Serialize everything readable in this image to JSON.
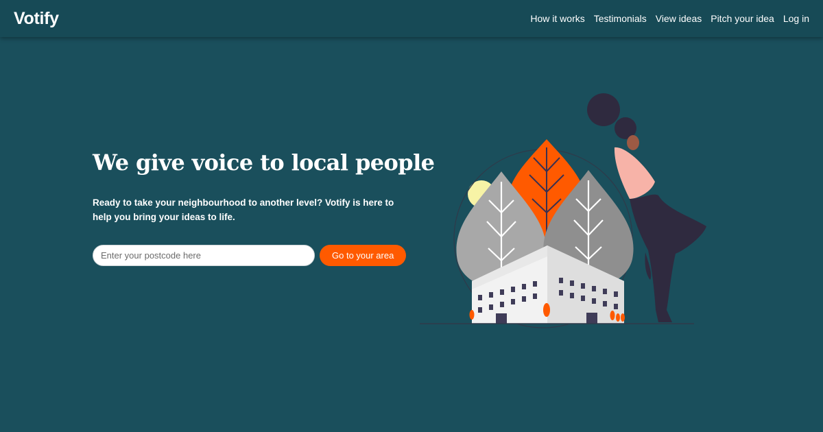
{
  "header": {
    "logo": "Votify",
    "nav": [
      {
        "label": "How it works"
      },
      {
        "label": "Testimonials"
      },
      {
        "label": "View ideas"
      },
      {
        "label": "Pitch your idea"
      },
      {
        "label": "Log in"
      }
    ]
  },
  "hero": {
    "title": "We give voice to local people",
    "subtitle": "Ready to take your neighbourhood to another level? Votify is here to help you bring your ideas to life.",
    "postcode_placeholder": "Enter your postcode here",
    "postcode_value": "",
    "cta_label": "Go to your area"
  },
  "colors": {
    "background": "#1a4f5c",
    "accent": "#ff5a00",
    "text": "#ffffff"
  }
}
